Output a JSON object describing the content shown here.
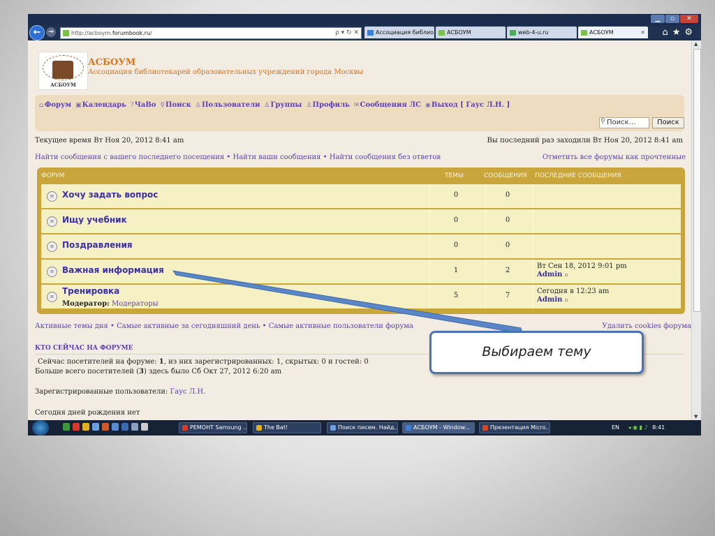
{
  "browser": {
    "address_prefix": "http://acboym.",
    "address_domain": "forumbook.ru",
    "address_suffix": "/",
    "address_tools": "ρ ▾ ↻ ✕",
    "tabs": [
      {
        "label": "Ассоциация библио...",
        "icon_color": "#3a7fd5"
      },
      {
        "label": "АСБОУМ",
        "icon_color": "#7cc04b"
      },
      {
        "label": "web-4-u.ru",
        "icon_color": "#4caa5a"
      },
      {
        "label": "АСБОУМ",
        "icon_color": "#7cc04b",
        "active": true
      }
    ],
    "tab_close": "✕",
    "nav_right_icons": "⌂★⚙"
  },
  "site": {
    "logo_label": "АСБОУМ",
    "name": "АСБОУМ",
    "description": "Ассоциация библиотекарей образовательных учреждений города Москвы"
  },
  "menu": [
    {
      "icon": "⌂",
      "label": "Форум"
    },
    {
      "icon": "▣",
      "label": "Календарь"
    },
    {
      "icon": "?",
      "label": "ЧаВо"
    },
    {
      "icon": "⚲",
      "label": "Поиск"
    },
    {
      "icon": "♙",
      "label": "Пользователи"
    },
    {
      "icon": "♙",
      "label": "Группы"
    },
    {
      "icon": "♙",
      "label": "Профиль"
    },
    {
      "icon": "✉",
      "label": "Сообщения ЛС"
    },
    {
      "icon": "◉",
      "label": "Выход [ Гаус Л.Н. ]"
    }
  ],
  "search": {
    "placeholder": "Поиск…",
    "button": "Поиск"
  },
  "info": {
    "current_time": "Текущее время Вт Ноя 20, 2012 8:41 am",
    "last_visit": "Вы последний раз заходили Вт Ноя 20, 2012 8:41 am",
    "links": "Найти сообщения с вашего последнего посещения • Найти ваши сообщения • Найти сообщения без ответов",
    "mark_read": "Отметить все форумы как прочтенные"
  },
  "forum_table": {
    "headers": {
      "forum": "ФОРУМ",
      "topics": "ТЕМЫ",
      "posts": "СООБЩЕНИЯ",
      "last": "ПОСЛЕДНИЕ СООБЩЕНИЯ"
    },
    "rows": [
      {
        "title": "Хочу задать вопрос",
        "topics": "0",
        "posts": "0",
        "last_date": "",
        "last_user": ""
      },
      {
        "title": "Ищу учебник",
        "topics": "0",
        "posts": "0",
        "last_date": "",
        "last_user": ""
      },
      {
        "title": "Поздравления",
        "topics": "0",
        "posts": "0",
        "last_date": "",
        "last_user": ""
      },
      {
        "title": "Важная информация",
        "topics": "1",
        "posts": "2",
        "last_date": "Вт Сен 18, 2012 9:01 pm",
        "last_user": "Admin"
      },
      {
        "title": "Тренировка",
        "topics": "5",
        "posts": "7",
        "last_date": "Сегодня в 12:23 am",
        "last_user": "Admin",
        "moderator_label": "Модератор:",
        "moderator_link": "Модераторы"
      }
    ]
  },
  "footer_links": {
    "left": "Активные темы дня • Самые активные за сегодняшний день • Самые активные пользователи форума",
    "delete_cookies": "Удалить cookies форума"
  },
  "who_online": {
    "heading": "КТО СЕЙЧАС НА ФОРУМЕ",
    "line1_a": "Сейчас посетителей на форуме: ",
    "line1_b": "1",
    "line1_c": ", из них зарегистрированных: 1, скрытых: 0 и гостей: 0",
    "line2_a": "Больше всего посетителей (",
    "line2_b": "3",
    "line2_c": ") здесь было Сб Окт 27, 2012 6:20 am",
    "registered_label": "Зарегистрированные пользователи: ",
    "registered_user": "Гаус Л.Н.",
    "birthdays": "Сегодня дней рождения нет"
  },
  "taskbar": {
    "items": [
      {
        "label": "РЕМОНТ Samsung ...",
        "icon_color": "#d63a2a"
      },
      {
        "label": "The Bat!",
        "icon_color": "#e0b020"
      },
      {
        "label": "Поиск писем. Найд...",
        "icon_color": "#6aa0e0"
      },
      {
        "label": "АСБОУМ - Window...",
        "icon_color": "#3a7fd5",
        "active": true
      },
      {
        "label": "Презентация Micro...",
        "icon_color": "#d0482a"
      }
    ],
    "lang": "EN",
    "clock": "8:41"
  },
  "callout": {
    "text": "Выбираем тему"
  }
}
